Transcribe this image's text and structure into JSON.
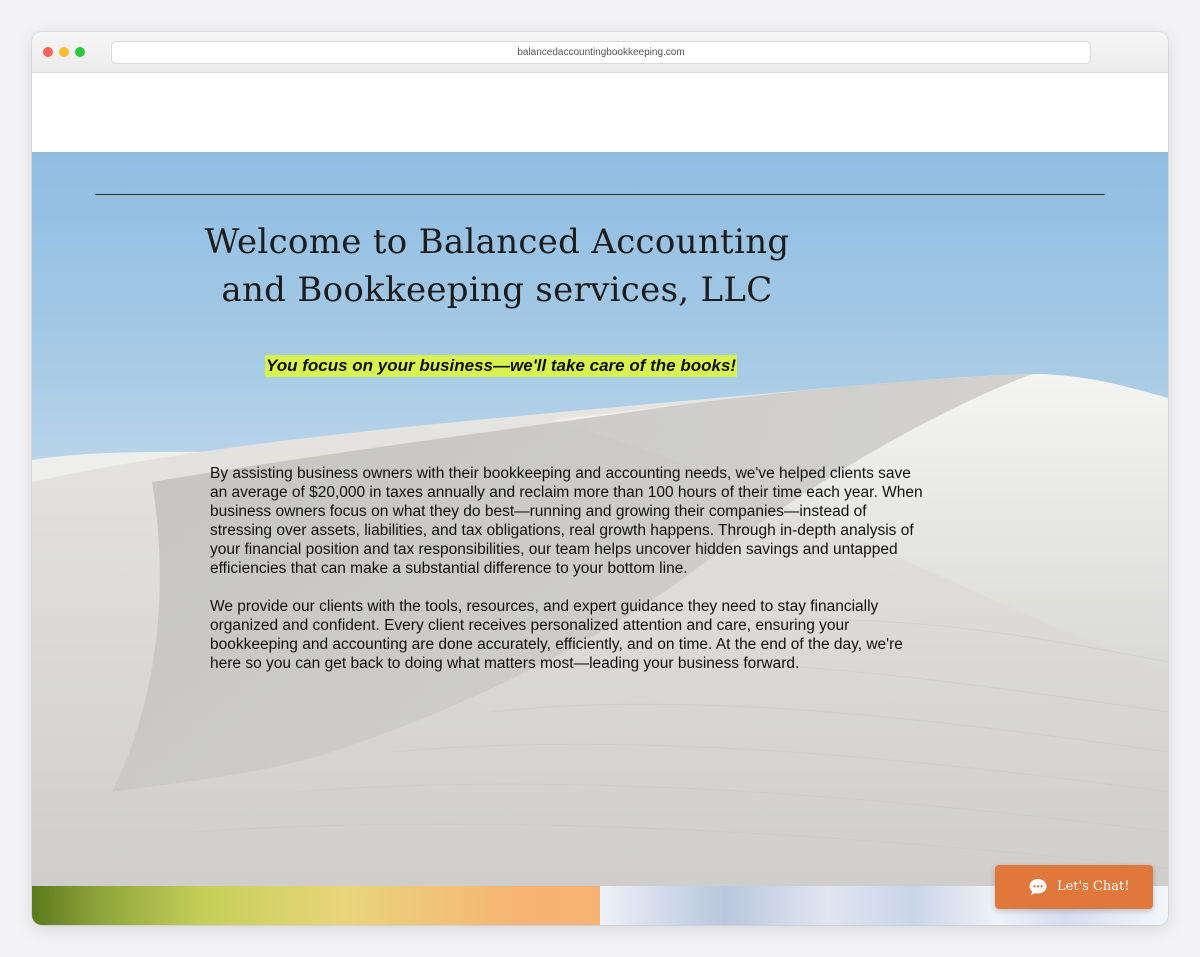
{
  "browser": {
    "url": "balancedaccountingbookkeeping.com"
  },
  "hero": {
    "title": "Welcome to Balanced Accounting and Bookkeeping services, LLC",
    "tagline": "You focus on your business—we'll take care of the books!",
    "paragraphs": [
      "By assisting business owners with their bookkeeping and accounting needs, we've helped clients save an average of $20,000 in taxes annually and reclaim more than 100 hours of their time each year. When business owners focus on what they do best—running and growing their companies—instead of stressing over assets, liabilities, and tax obligations, real growth happens. Through in-depth analysis of your financial position and tax responsibilities, our team helps uncover hidden savings and untapped efficiencies that can make a substantial difference to your bottom line.",
      "We provide our clients with the tools, resources, and expert guidance they need to stay financially organized and confident. Every client receives personalized attention and care, ensuring your bookkeeping and accounting are done accurately, efficiently, and on time. At the end of the day, we're here so you can get back to doing what matters most—leading your business forward."
    ]
  },
  "chat": {
    "label": "Let's Chat!",
    "icon": "chat-bubble-icon"
  },
  "colors": {
    "tagline_highlight": "#d8f24f",
    "chat_button": "#e1783b",
    "sky": "#8fbde2"
  }
}
